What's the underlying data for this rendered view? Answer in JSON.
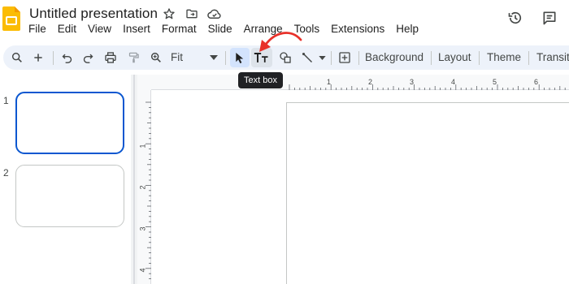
{
  "app": {
    "title": "Untitled presentation",
    "logo_icon": "slides-logo-icon",
    "title_icons": [
      "star-icon",
      "move-to-folder-icon",
      "cloud-saved-icon"
    ],
    "top_right_icons": [
      "version-history-icon",
      "comments-icon"
    ]
  },
  "menu": {
    "items": [
      "File",
      "Edit",
      "View",
      "Insert",
      "Format",
      "Slide",
      "Arrange",
      "Tools",
      "Extensions",
      "Help"
    ]
  },
  "toolbar": {
    "zoom_value": "Fit",
    "background_label": "Background",
    "layout_label": "Layout",
    "theme_label": "Theme",
    "transition_label": "Transit",
    "icons": [
      "search-icon",
      "new-slide-icon",
      "undo-icon",
      "redo-icon",
      "print-icon",
      "paint-format-icon",
      "zoom-icon",
      "select-icon",
      "text-box-icon",
      "shape-icon",
      "line-icon",
      "comment-add-icon"
    ]
  },
  "tooltip": {
    "text": "Text box"
  },
  "filmstrip": {
    "slides": [
      {
        "number": "1",
        "selected": true
      },
      {
        "number": "2",
        "selected": false
      }
    ]
  },
  "rulers": {
    "horizontal": [
      "1",
      "2",
      "3",
      "4",
      "5",
      "6"
    ],
    "vertical": [
      "1",
      "2",
      "3",
      "4"
    ]
  },
  "colors": {
    "accent": "#0b57d0",
    "toolbar_bg": "#edf2fa",
    "annotation_arrow": "#e8312a",
    "logo": "#fbbc04"
  }
}
